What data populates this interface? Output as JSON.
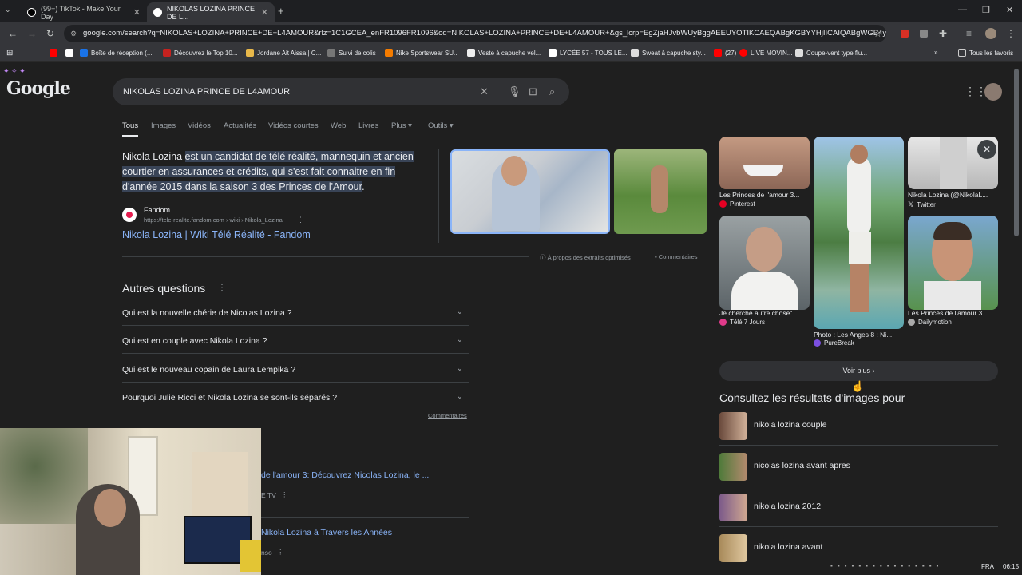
{
  "browser": {
    "tabs": [
      {
        "title": "(99+) TikTok - Make Your Day"
      },
      {
        "title": "NIKOLAS LOZINA PRINCE DE L..."
      }
    ],
    "url": "google.com/search?q=NIKOLAS+LOZINA+PRINCE+DE+L4AMOUR&rlz=1C1GCEA_enFR1096FR1096&oq=NIKOLAS+LOZINA+PRINCE+DE+L4AMOUR+&gs_lcrp=EgZjaHJvbWUyBggAEEUYOTIKCAEQABgKGBYYHjIICAIQABgWGB4yCAgDEA...",
    "bookmarks": [
      "Boîte de réception (...",
      "Découvrez le Top 10...",
      "Jordane Ait Aissa | C...",
      "Suivi de colis",
      "Nike Sportswear SU...",
      "Veste à capuche vel...",
      "LYCÉE 57 - TOUS LE...",
      "Sweat à capuche sty...",
      "(27)",
      "LIVE MOVIN...",
      "Coupe-vent type flu..."
    ],
    "all_bookmarks": "Tous les favoris"
  },
  "google": {
    "logo": "Google",
    "query": "NIKOLAS LOZINA PRINCE DE L4AMOUR",
    "tabs": [
      "Tous",
      "Images",
      "Vidéos",
      "Actualités",
      "Vidéos courtes",
      "Web",
      "Livres",
      "Plus",
      "Outils"
    ],
    "snippet": {
      "lead": "Nikola Lozina",
      "highlight": "est un candidat de télé réalité, mannequin et ancien courtier en assurances et crédits, qui s'est fait connaitre en fin d'année 2015 dans la saison 3 des Princes de l'Amour",
      "end": ".",
      "source_name": "Fandom",
      "source_url": "https://tele-realite.fandom.com › wiki › Nikola_Lozina",
      "link_title": "Nikola Lozina | Wiki Télé Réalité - Fandom",
      "about": "À propos des extraits optimisés",
      "feedback": "Commentaires"
    },
    "paa": {
      "title": "Autres questions",
      "questions": [
        "Qui est la nouvelle chérie de Nicolas Lozina ?",
        "Qui est en couple avec Nikola Lozina ?",
        "Qui est le nouveau copain de Laura Lempika ?",
        "Pourquoi Julie Ricci et Nikola Lozina se sont-ils séparés ?"
      ],
      "feedback": "Commentaires"
    },
    "partial_results": [
      {
        "title": "de l'amour 3: Découvrez Nicolas Lozina, le ...",
        "meta": "E TV"
      },
      {
        "title": "Nikola Lozina à Travers les Années",
        "meta": "nso"
      }
    ],
    "images": [
      {
        "caption": "Les Princes de l'amour 3...",
        "source": "Pinterest"
      },
      {
        "caption": "Photo : Les Anges 8 : Ni...",
        "source": "PureBreak"
      },
      {
        "caption": "Nikola Lozina (@NikolaL...",
        "source": "Twitter"
      },
      {
        "caption": "Je cherche autre chose\" ...",
        "source": "Télé 7 Jours"
      },
      {
        "caption": "Les Princes de l'amour 3...",
        "source": "Dailymotion"
      }
    ],
    "see_more": "Voir plus",
    "related_title": "Consultez les résultats d'images pour",
    "related": [
      "nikola lozina couple",
      "nicolas lozina avant apres",
      "nikola lozina 2012",
      "nikola lozina avant"
    ]
  },
  "tray": {
    "lang": "FRA",
    "time": "06:15"
  }
}
